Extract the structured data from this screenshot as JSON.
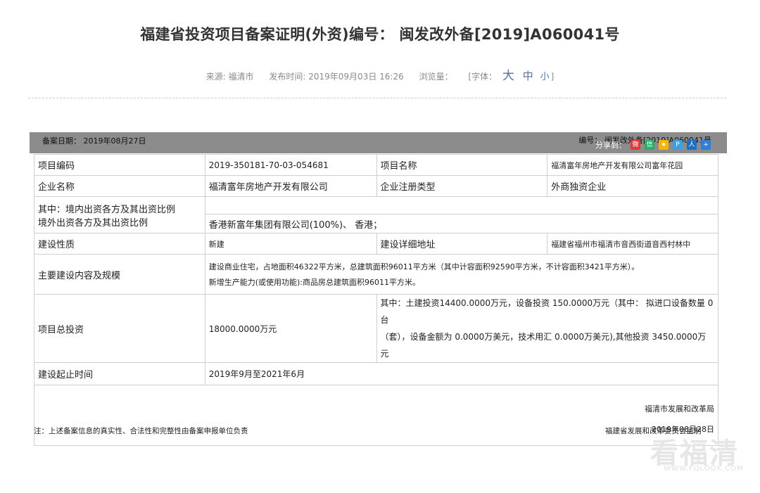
{
  "title": "福建省投资项目备案证明(外资)编号： 闽发改外备[2019]A060041号",
  "meta": {
    "source": "来源: 福清市",
    "publish": "发布时间: 2019年09月03日 16:26",
    "views": "浏览量：",
    "font_label": "[字体：",
    "font_big": "大",
    "font_mid": "中",
    "font_small": "小",
    "font_close": "]"
  },
  "bar": {
    "record_date": "备案日期： 2019年08月27日",
    "number": "编号：  闽发改外备[2019]A060041号",
    "share_label": "分享到："
  },
  "share_icons": [
    {
      "name": "weibo-icon",
      "glyph": "微",
      "color": "#e4393c"
    },
    {
      "name": "wechat-icon",
      "glyph": "信",
      "color": "#2aae67"
    },
    {
      "name": "qzone-icon",
      "glyph": "★",
      "color": "#f5b400"
    },
    {
      "name": "tencent-weibo-icon",
      "glyph": "P",
      "color": "#3ba0e6"
    },
    {
      "name": "renren-icon",
      "glyph": "人",
      "color": "#1a6fc4"
    },
    {
      "name": "more-icon",
      "glyph": "+",
      "color": "#2f7fd8"
    }
  ],
  "rows": {
    "code_label": "项目编码",
    "code_value": "2019-350181-70-03-054681",
    "name_label": "项目名称",
    "name_value": "福清富年房地产开发有限公司富年花园",
    "company_label": "企业名称",
    "company_value": "福清富年房地产开发有限公司",
    "reg_type_label": "企业注册类型",
    "reg_type_value": "外商独资企业",
    "ratio_label_1": "其中：境内出资各方及其出资比例",
    "ratio_label_2": "境外出资各方及其出资比例",
    "ratio_domestic_value": "",
    "ratio_foreign_value": "香港新富年集团有限公司(100%)、 香港；",
    "nature_label": "建设性质",
    "nature_value": "新建",
    "address_label": "建设详细地址",
    "address_value": "福建省福州市福清市音西街道音西村林中",
    "content_label": "主要建设内容及规模",
    "content_value_1": "建设商业住宅，占地面积46322平方米，总建筑面积96011平方米（其中计容面积92590平方米，不计容面积3421平方米）。",
    "content_value_2": "新增生产能力(或使用功能):商品房总建筑面积96011平方米。",
    "invest_label": "项目总投资",
    "invest_value": "18000.0000万元",
    "invest_detail_1": "其中：土建投资14400.0000万元，设备投资 150.0000万元（其中： 拟进口设备数量 0台",
    "invest_detail_2": "（套），设备金额为 0.0000万美元，技术用汇 0.0000万美元),其他投资 3450.0000万元",
    "period_label": "建设起止时间",
    "period_value": "2019年9月至2021年6月",
    "issuer": "福清市发展和改革局",
    "issue_date": "2019年08月28日"
  },
  "footer": {
    "note": "注：上述备案信息的真实性、合法性和完整性由备案申报单位负责",
    "supervisor": "福建省发展和改革委员会监制"
  },
  "watermark": {
    "text": "看福清",
    "url": "WWW.FQLOOK.COM"
  }
}
